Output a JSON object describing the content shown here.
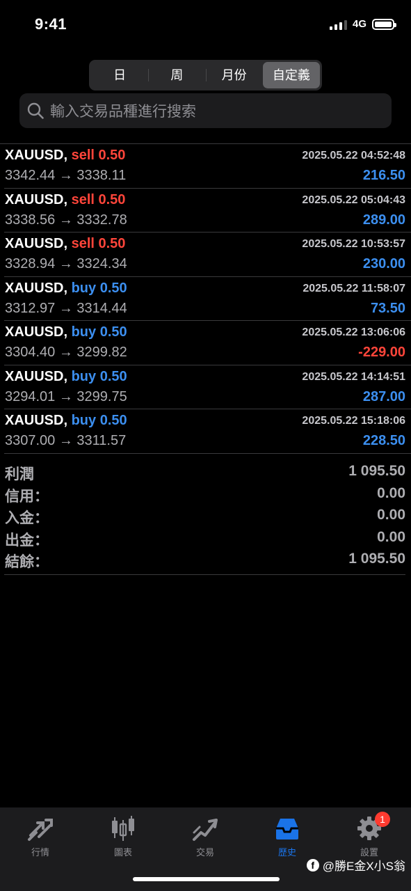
{
  "status_bar": {
    "time": "9:41",
    "network": "4G"
  },
  "period_tabs": [
    {
      "label": "日",
      "active": false
    },
    {
      "label": "周",
      "active": false
    },
    {
      "label": "月份",
      "active": false
    },
    {
      "label": "自定義",
      "active": true
    }
  ],
  "search": {
    "placeholder": "輸入交易品種進行搜索"
  },
  "deals": [
    {
      "symbol": "XAUUSD,",
      "side": "sell",
      "volume": "0.50",
      "time": "2025.05.22 04:52:48",
      "open": "3342.44",
      "close": "3338.11",
      "profit": "216.50"
    },
    {
      "symbol": "XAUUSD,",
      "side": "sell",
      "volume": "0.50",
      "time": "2025.05.22 05:04:43",
      "open": "3338.56",
      "close": "3332.78",
      "profit": "289.00"
    },
    {
      "symbol": "XAUUSD,",
      "side": "sell",
      "volume": "0.50",
      "time": "2025.05.22 10:53:57",
      "open": "3328.94",
      "close": "3324.34",
      "profit": "230.00"
    },
    {
      "symbol": "XAUUSD,",
      "side": "buy",
      "volume": "0.50",
      "time": "2025.05.22 11:58:07",
      "open": "3312.97",
      "close": "3314.44",
      "profit": "73.50"
    },
    {
      "symbol": "XAUUSD,",
      "side": "buy",
      "volume": "0.50",
      "time": "2025.05.22 13:06:06",
      "open": "3304.40",
      "close": "3299.82",
      "profit": "-229.00"
    },
    {
      "symbol": "XAUUSD,",
      "side": "buy",
      "volume": "0.50",
      "time": "2025.05.22 14:14:51",
      "open": "3294.01",
      "close": "3299.75",
      "profit": "287.00"
    },
    {
      "symbol": "XAUUSD,",
      "side": "buy",
      "volume": "0.50",
      "time": "2025.05.22 15:18:06",
      "open": "3307.00",
      "close": "3311.57",
      "profit": "228.50"
    }
  ],
  "summary": [
    {
      "label": "利潤",
      "value": "1 095.50"
    },
    {
      "label": "信用：",
      "value": "0.00"
    },
    {
      "label": "入金：",
      "value": "0.00"
    },
    {
      "label": "出金：",
      "value": "0.00"
    },
    {
      "label": "結餘：",
      "value": "1 095.50"
    }
  ],
  "tab_bar": [
    {
      "label": "行情",
      "icon": "quotes-arrows-icon",
      "active": false
    },
    {
      "label": "圖表",
      "icon": "candlestick-chart-icon",
      "active": false
    },
    {
      "label": "交易",
      "icon": "trade-trend-icon",
      "active": false
    },
    {
      "label": "歷史",
      "icon": "history-inbox-icon",
      "active": true
    },
    {
      "label": "設置",
      "icon": "settings-gear-icon",
      "active": false,
      "badge": "1"
    }
  ],
  "watermark": {
    "text": "@勝E金X小S翁"
  },
  "colors": {
    "sell": "#ff453a",
    "buy": "#3c8ff0",
    "profit_positive": "#3c8ff0",
    "profit_negative": "#ff453a",
    "active_tab": "#1a73e8"
  }
}
